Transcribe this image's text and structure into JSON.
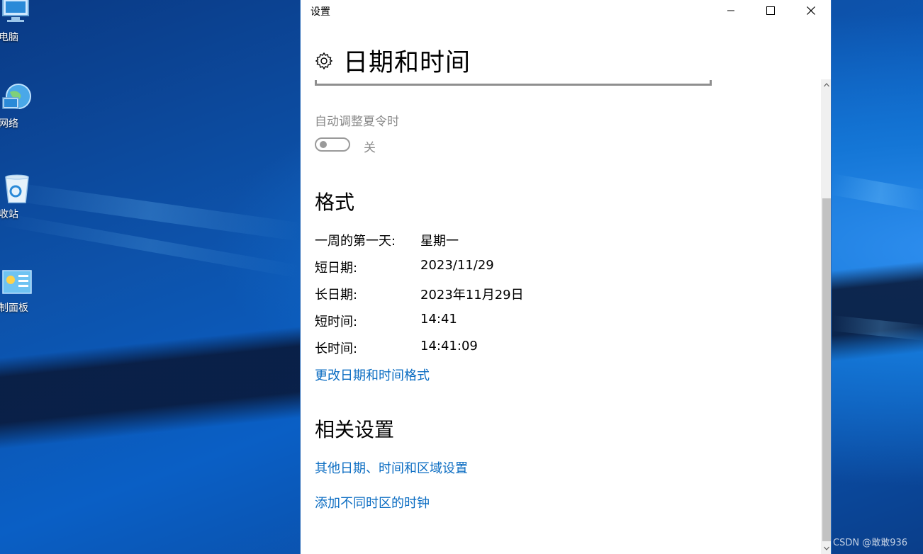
{
  "desktop": {
    "icons": [
      {
        "label": "此电脑",
        "visible_label": "电脑"
      },
      {
        "label": "网络",
        "visible_label": "网络"
      },
      {
        "label": "回收站",
        "visible_label": "收站"
      },
      {
        "label": "控制面板",
        "visible_label": "制面板"
      }
    ],
    "watermark": "CSDN @敢敢936"
  },
  "window": {
    "title": "设置",
    "controls": [
      "minimize-icon",
      "maximize-icon",
      "close-icon"
    ],
    "header": {
      "icon": "gear-icon",
      "title": "日期和时间"
    },
    "dst": {
      "label": "自动调整夏令时",
      "state_label": "关",
      "enabled": false
    },
    "format_section": {
      "title": "格式",
      "rows": [
        {
          "key": "一周的第一天:",
          "value": "星期一"
        },
        {
          "key": "短日期:",
          "value": "2023/11/29"
        },
        {
          "key": "长日期:",
          "value": "2023年11月29日"
        },
        {
          "key": "短时间:",
          "value": "14:41"
        },
        {
          "key": "长时间:",
          "value": "14:41:09"
        }
      ],
      "change_link": "更改日期和时间格式"
    },
    "related_section": {
      "title": "相关设置",
      "links": [
        "其他日期、时间和区域设置",
        "添加不同时区的时钟"
      ]
    }
  },
  "colors": {
    "link": "#0a6cc2",
    "muted_text": "#8a8a8a",
    "desktop_blue": "#0d52aa"
  }
}
